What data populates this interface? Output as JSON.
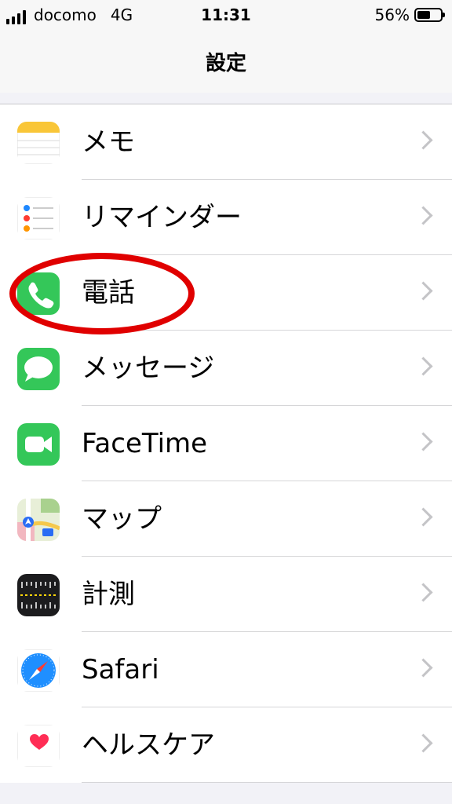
{
  "status_bar": {
    "carrier": "docomo",
    "network": "4G",
    "time": "11:31",
    "battery": "56%",
    "battery_level": 0.56
  },
  "nav": {
    "title": "設定"
  },
  "settings": {
    "items": [
      {
        "label": "メモ",
        "icon": "notes-icon"
      },
      {
        "label": "リマインダー",
        "icon": "reminders-icon"
      },
      {
        "label": "電話",
        "icon": "phone-icon"
      },
      {
        "label": "メッセージ",
        "icon": "messages-icon"
      },
      {
        "label": "FaceTime",
        "icon": "facetime-icon"
      },
      {
        "label": "マップ",
        "icon": "maps-icon"
      },
      {
        "label": "計測",
        "icon": "measure-icon"
      },
      {
        "label": "Safari",
        "icon": "safari-icon"
      },
      {
        "label": "ヘルスケア",
        "icon": "health-icon"
      }
    ]
  },
  "colors": {
    "highlight": "#e00000",
    "phone_green": "#34c759",
    "background": "#f2f2f7"
  }
}
